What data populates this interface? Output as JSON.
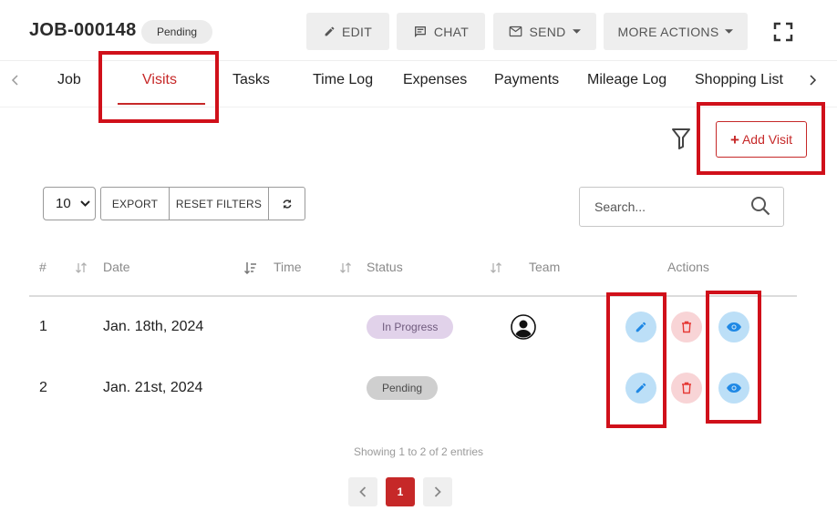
{
  "header": {
    "job_number": "JOB-000148",
    "status": "Pending",
    "buttons": {
      "edit": "EDIT",
      "chat": "CHAT",
      "send": "SEND",
      "more": "MORE ACTIONS"
    },
    "icons": [
      "pencil-icon",
      "chat-icon",
      "mail-icon",
      "fullscreen-icon"
    ]
  },
  "tabs": [
    {
      "label": "Job"
    },
    {
      "label": "Visits",
      "active": true
    },
    {
      "label": "Tasks"
    },
    {
      "label": "Time Log"
    },
    {
      "label": "Expenses"
    },
    {
      "label": "Payments"
    },
    {
      "label": "Mileage Log"
    },
    {
      "label": "Shopping List"
    }
  ],
  "toolbar": {
    "add_visit": "Add Visit",
    "page_length": "10",
    "export": "EXPORT",
    "reset_filters": "RESET FILTERS",
    "search_placeholder": "Search..."
  },
  "table": {
    "columns": [
      "#",
      "Date",
      "Time",
      "Status",
      "Team",
      "Actions"
    ],
    "rows": [
      {
        "num": "1",
        "date": "Jan. 18th, 2024",
        "time": "",
        "status": "In Progress",
        "team": "avatar"
      },
      {
        "num": "2",
        "date": "Jan. 21st, 2024",
        "time": "",
        "status": "Pending",
        "team": ""
      }
    ]
  },
  "footer": {
    "info": "Showing 1 to 2 of 2 entries",
    "current_page": "1"
  },
  "colors": {
    "accent": "#c62828",
    "highlight_box": "#d0101a",
    "in_progress_badge": "#e1d2ea",
    "pending_badge": "#cfcfcf",
    "edit_action": "#bcdff7",
    "delete_action": "#f8d4d6"
  }
}
